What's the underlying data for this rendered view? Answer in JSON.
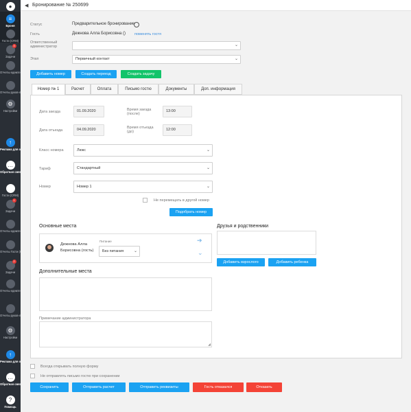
{
  "header": {
    "title": "Бронирование № 250699"
  },
  "sidebar": {
    "top_items": [
      {
        "label": "",
        "icon": "user-avatar-icon",
        "badge": ""
      },
      {
        "label": "Броня",
        "icon": "menu-lines-icon",
        "badge": ""
      },
      {
        "label": "Гости (CRM)",
        "icon": "guests-icon",
        "badge": ""
      },
      {
        "label": "Задачи",
        "icon": "tasks-icon",
        "badge": "3"
      },
      {
        "label": "Отчеты едемте.ру",
        "icon": "report-icon",
        "badge": ""
      },
      {
        "label": "Отчеты руков-ля",
        "icon": "report-icon",
        "badge": ""
      },
      {
        "label": "Настройки",
        "icon": "gear-icon",
        "badge": ""
      }
    ],
    "promo_items": [
      {
        "label": "Реклама для отелей",
        "icon": "arrow-up-icon"
      },
      {
        "label": "Обратная связь",
        "icon": "chat-icon"
      }
    ],
    "mid_items": [
      {
        "label": "Гости (CRM)",
        "icon": "guests-icon",
        "badge": ""
      },
      {
        "label": "Задачи",
        "icon": "tasks-icon",
        "badge": "1"
      },
      {
        "label": "Отчеты едемте.ру",
        "icon": "report-icon",
        "badge": ""
      },
      {
        "label": "Отчеты Гости (CRM)",
        "icon": "report-icon",
        "badge": ""
      },
      {
        "label": "Задачи",
        "icon": "tasks-icon",
        "badge": "2"
      },
      {
        "label": "Отчеты едемте.ру",
        "icon": "report-icon",
        "badge": ""
      },
      {
        "label": "Отчеты руков-ля",
        "icon": "report-icon",
        "badge": ""
      },
      {
        "label": "Настройки",
        "icon": "gear-icon",
        "badge": ""
      }
    ],
    "bottom_items": [
      {
        "label": "Реклама для отелей",
        "icon": "arrow-up-icon"
      },
      {
        "label": "Обратная связь",
        "icon": "chat-icon"
      },
      {
        "label": "Помощь",
        "icon": "help-icon"
      }
    ]
  },
  "form": {
    "status_label": "Статус",
    "status_value": "Предварительное бронирование",
    "guest_label": "Гость",
    "guest_value": "Дежнова Алла Борисовна ()",
    "change_guest_link": "поменять гостя",
    "admin_label": "Ответственный администратор",
    "admin_value": "",
    "stage_label": "Этап",
    "stage_value": "Первичный контакт"
  },
  "actions": {
    "add_room": "Добавить номер",
    "create_transfer": "Создать переезд",
    "create_task": "Создать задачу"
  },
  "tabs": [
    "Номер № 1",
    "Расчет",
    "Оплата",
    "Письмо гостю",
    "Документы",
    "Доп. информация"
  ],
  "room": {
    "checkin_label": "Дата заезда",
    "checkin_value": "01.09.2020",
    "checkin_time_label": "Время заезда (после)",
    "checkin_time_value": "13:00",
    "checkout_label": "Дата отъезда",
    "checkout_value": "04.09.2020",
    "checkout_time_label": "Время отъезда (до)",
    "checkout_time_value": "12:00",
    "room_class_label": "Класс номера",
    "room_class_value": "Люкс",
    "tariff_label": "Тариф",
    "tariff_value": "Стандартный",
    "room_label": "Номер",
    "room_value": "Номер 1",
    "no_move_label": "Не перемещать в другой номер",
    "pick_room_button": "Подобрать номер"
  },
  "main_places": {
    "title": "Основные места",
    "guest_name": "Дежнова Алла Борисовна (гость)",
    "meal_label": "Питание",
    "meal_value": "Без питания"
  },
  "friends": {
    "title": "Друзья и родственники",
    "add_adult": "Добавить взрослого",
    "add_child": "Добавить ребенка"
  },
  "extra_places": {
    "title": "Дополнительные места"
  },
  "admin_note": {
    "label": "Примечание администратора"
  },
  "footer": {
    "always_full_form": "Всегда открывать полную форму",
    "no_email": "Не отправлять письмо гостю при сохранении",
    "save": "Сохранить",
    "send_calc": "Отправить расчет",
    "send_details": "Отправить реквизиты",
    "guest_refused": "Гость отказался",
    "refuse": "Отказать"
  },
  "colors": {
    "primary": "#1ba2f2",
    "success": "#12c46a",
    "danger": "#f44336",
    "sidebar": "#2a2f36"
  }
}
